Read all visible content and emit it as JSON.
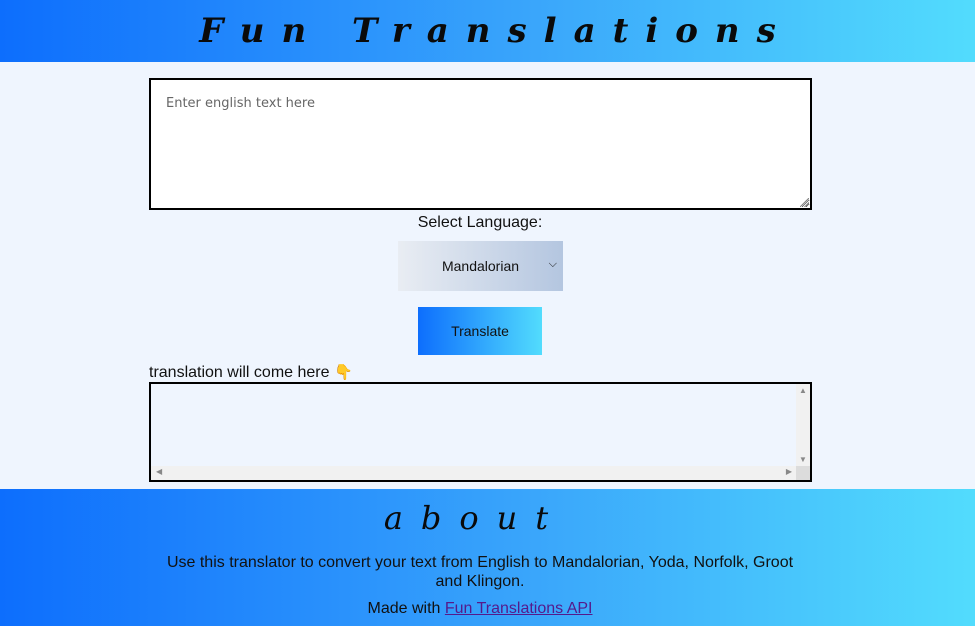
{
  "header": {
    "title": "Fun Translations"
  },
  "input": {
    "placeholder": "Enter english text here",
    "value": ""
  },
  "language": {
    "label": "Select Language:",
    "selected": "Mandalorian"
  },
  "translate_button": {
    "label": "Translate"
  },
  "output": {
    "label": "translation will come here",
    "label_emoji": "👇",
    "value": ""
  },
  "footer": {
    "heading": "about",
    "description": "Use this translator to convert your text from English to Mandalorian, Yoda, Norfolk, Groot and Klingon.",
    "made_with_prefix": "Made with",
    "api_link_text": "Fun Translations API"
  },
  "colors": {
    "gradient_start": "#0d6efd",
    "gradient_end": "#52dcfd",
    "page_background": "#eff5fe",
    "link": "#551a8b"
  }
}
